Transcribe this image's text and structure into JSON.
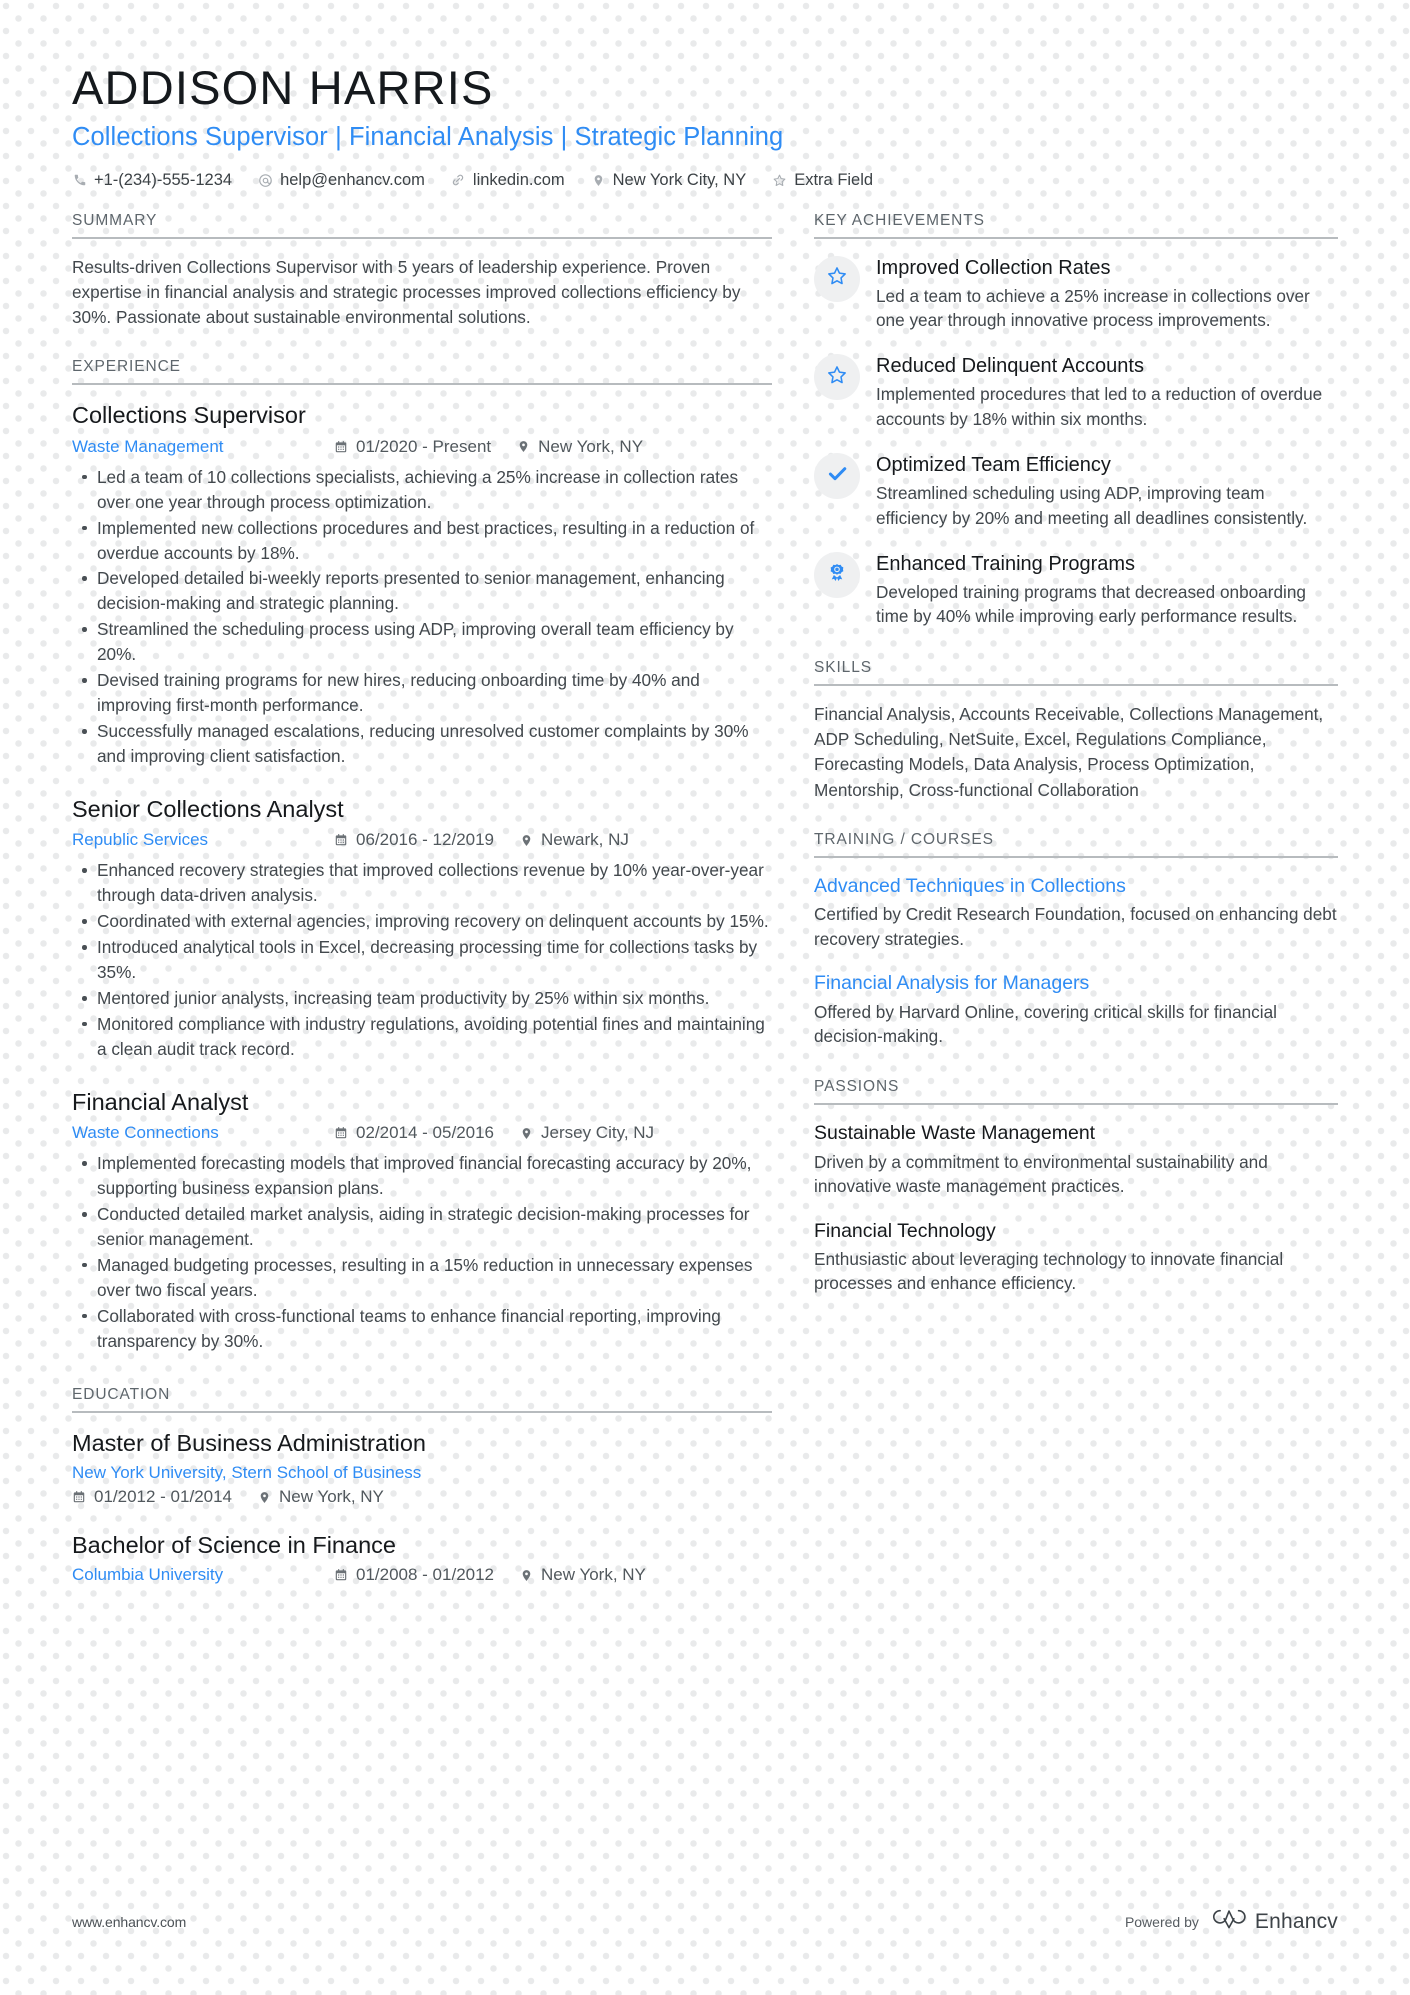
{
  "accent_color": "#2f8cf4",
  "text_color": "#42484d",
  "heading_color": "#16191c",
  "rule_color": "#b7bbbe",
  "header": {
    "name": "ADDISON HARRIS",
    "headline": "Collections Supervisor | Financial Analysis | Strategic Planning",
    "contacts": [
      {
        "icon": "phone-icon",
        "value": "+1-(234)-555-1234"
      },
      {
        "icon": "email-icon",
        "value": "help@enhancv.com"
      },
      {
        "icon": "link-icon",
        "value": "linkedin.com"
      },
      {
        "icon": "location-pin-icon",
        "value": "New York City, NY"
      },
      {
        "icon": "star-icon",
        "value": "Extra Field"
      }
    ]
  },
  "summary": {
    "heading": "SUMMARY",
    "text": "Results-driven Collections Supervisor with 5 years of leadership experience. Proven expertise in financial analysis and strategic processes improved collections efficiency by 30%. Passionate about sustainable environmental solutions."
  },
  "experience": {
    "heading": "EXPERIENCE",
    "jobs": [
      {
        "title": "Collections Supervisor",
        "company": "Waste Management",
        "dates": "01/2020 - Present",
        "location": "New York, NY",
        "bullets": [
          "Led a team of 10 collections specialists, achieving a 25% increase in collection rates over one year through process optimization.",
          "Implemented new collections procedures and best practices, resulting in a reduction of overdue accounts by 18%.",
          "Developed detailed bi-weekly reports presented to senior management, enhancing decision-making and strategic planning.",
          "Streamlined the scheduling process using ADP, improving overall team efficiency by 20%.",
          "Devised training programs for new hires, reducing onboarding time by 40% and improving first-month performance.",
          "Successfully managed escalations, reducing unresolved customer complaints by 30% and improving client satisfaction."
        ]
      },
      {
        "title": "Senior Collections Analyst",
        "company": "Republic Services",
        "dates": "06/2016 - 12/2019",
        "location": "Newark, NJ",
        "bullets": [
          "Enhanced recovery strategies that improved collections revenue by 10% year-over-year through data-driven analysis.",
          "Coordinated with external agencies, improving recovery on delinquent accounts by 15%.",
          "Introduced analytical tools in Excel, decreasing processing time for collections tasks by 35%.",
          "Mentored junior analysts, increasing team productivity by 25% within six months.",
          "Monitored compliance with industry regulations, avoiding potential fines and maintaining a clean audit track record."
        ]
      },
      {
        "title": "Financial Analyst",
        "company": "Waste Connections",
        "dates": "02/2014 - 05/2016",
        "location": "Jersey City, NJ",
        "bullets": [
          "Implemented forecasting models that improved financial forecasting accuracy by 20%, supporting business expansion plans.",
          "Conducted detailed market analysis, aiding in strategic decision-making processes for senior management.",
          "Managed budgeting processes, resulting in a 15% reduction in unnecessary expenses over two fiscal years.",
          "Collaborated with cross-functional teams to enhance financial reporting, improving transparency by 30%."
        ]
      }
    ]
  },
  "education": {
    "heading": "EDUCATION",
    "entries": [
      {
        "degree": "Master of Business Administration",
        "school": "New York University, Stern School of Business",
        "dates": "01/2012 - 01/2014",
        "location": "New York, NY",
        "layout": "stacked"
      },
      {
        "degree": "Bachelor of Science in Finance",
        "school": "Columbia University",
        "dates": "01/2008 - 01/2012",
        "location": "New York, NY",
        "layout": "inline"
      }
    ]
  },
  "achievements": {
    "heading": "KEY ACHIEVEMENTS",
    "items": [
      {
        "icon": "star-outline-icon",
        "title": "Improved Collection Rates",
        "desc": "Led a team to achieve a 25% increase in collections over one year through innovative process improvements."
      },
      {
        "icon": "star-outline-icon",
        "title": "Reduced Delinquent Accounts",
        "desc": "Implemented procedures that led to a reduction of overdue accounts by 18% within six months."
      },
      {
        "icon": "check-icon",
        "title": "Optimized Team Efficiency",
        "desc": "Streamlined scheduling using ADP, improving team efficiency by 20% and meeting all deadlines consistently."
      },
      {
        "icon": "award-medal-icon",
        "title": "Enhanced Training Programs",
        "desc": "Developed training programs that decreased onboarding time by 40% while improving early performance results."
      }
    ]
  },
  "skills": {
    "heading": "SKILLS",
    "text": "Financial Analysis, Accounts Receivable, Collections Management, ADP Scheduling, NetSuite, Excel, Regulations Compliance, Forecasting Models, Data Analysis, Process Optimization, Mentorship, Cross-functional Collaboration"
  },
  "training": {
    "heading": "TRAINING / COURSES",
    "courses": [
      {
        "title": "Advanced Techniques in Collections",
        "desc": "Certified by Credit Research Foundation, focused on enhancing debt recovery strategies."
      },
      {
        "title": "Financial Analysis for Managers",
        "desc": "Offered by Harvard Online, covering critical skills for financial decision-making."
      }
    ]
  },
  "passions": {
    "heading": "PASSIONS",
    "items": [
      {
        "title": "Sustainable Waste Management",
        "desc": "Driven by a commitment to environmental sustainability and innovative waste management practices."
      },
      {
        "title": "Financial Technology",
        "desc": "Enthusiastic about leveraging technology to innovate financial processes and enhance efficiency."
      }
    ]
  },
  "footer": {
    "url": "www.enhancv.com",
    "powered_by": "Powered by",
    "brand": "Enhancv"
  }
}
